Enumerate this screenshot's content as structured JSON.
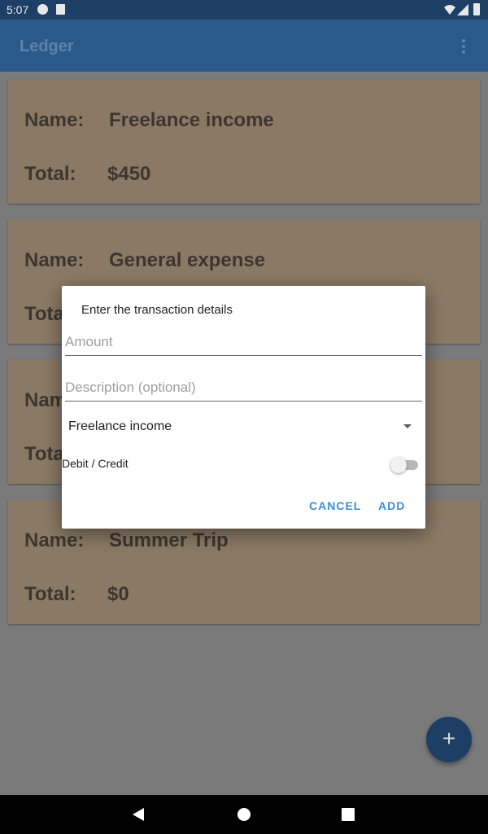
{
  "status_bar": {
    "time": "5:07",
    "icons": [
      "notification-app-icon",
      "sd-card-icon",
      "wifi-icon",
      "signal-icon",
      "battery-icon"
    ]
  },
  "app_bar": {
    "title": "Ledger",
    "menu_icon": "overflow-menu-icon"
  },
  "accounts": [
    {
      "name_label": "Name:",
      "name": "Freelance income",
      "total_label": "Total:",
      "total": "$450"
    },
    {
      "name_label": "Name:",
      "name": "General expense",
      "total_label": "Total:",
      "total": ""
    },
    {
      "name_label": "Name:",
      "name": "",
      "total_label": "Total:",
      "total": ""
    },
    {
      "name_label": "Name:",
      "name": "Summer Trip",
      "total_label": "Total:",
      "total": "$0"
    }
  ],
  "dialog": {
    "title": "Enter the transaction details",
    "amount_placeholder": "Amount",
    "description_placeholder": "Description (optional)",
    "account_selected": "Freelance income",
    "switch_label": "Debit / Credit",
    "switch_on": false,
    "cancel_label": "CANCEL",
    "add_label": "ADD"
  },
  "fab": {
    "icon": "plus-icon",
    "glyph": "+"
  },
  "nav_bar": {
    "icons": [
      "back-icon",
      "home-icon",
      "recents-icon"
    ]
  },
  "colors": {
    "status_bar": "#1d3f66",
    "app_bar": "#2a5a8c",
    "card": "#8a7a65",
    "dialog_button": "#3a8ed6",
    "fab": "#1d3f66"
  }
}
